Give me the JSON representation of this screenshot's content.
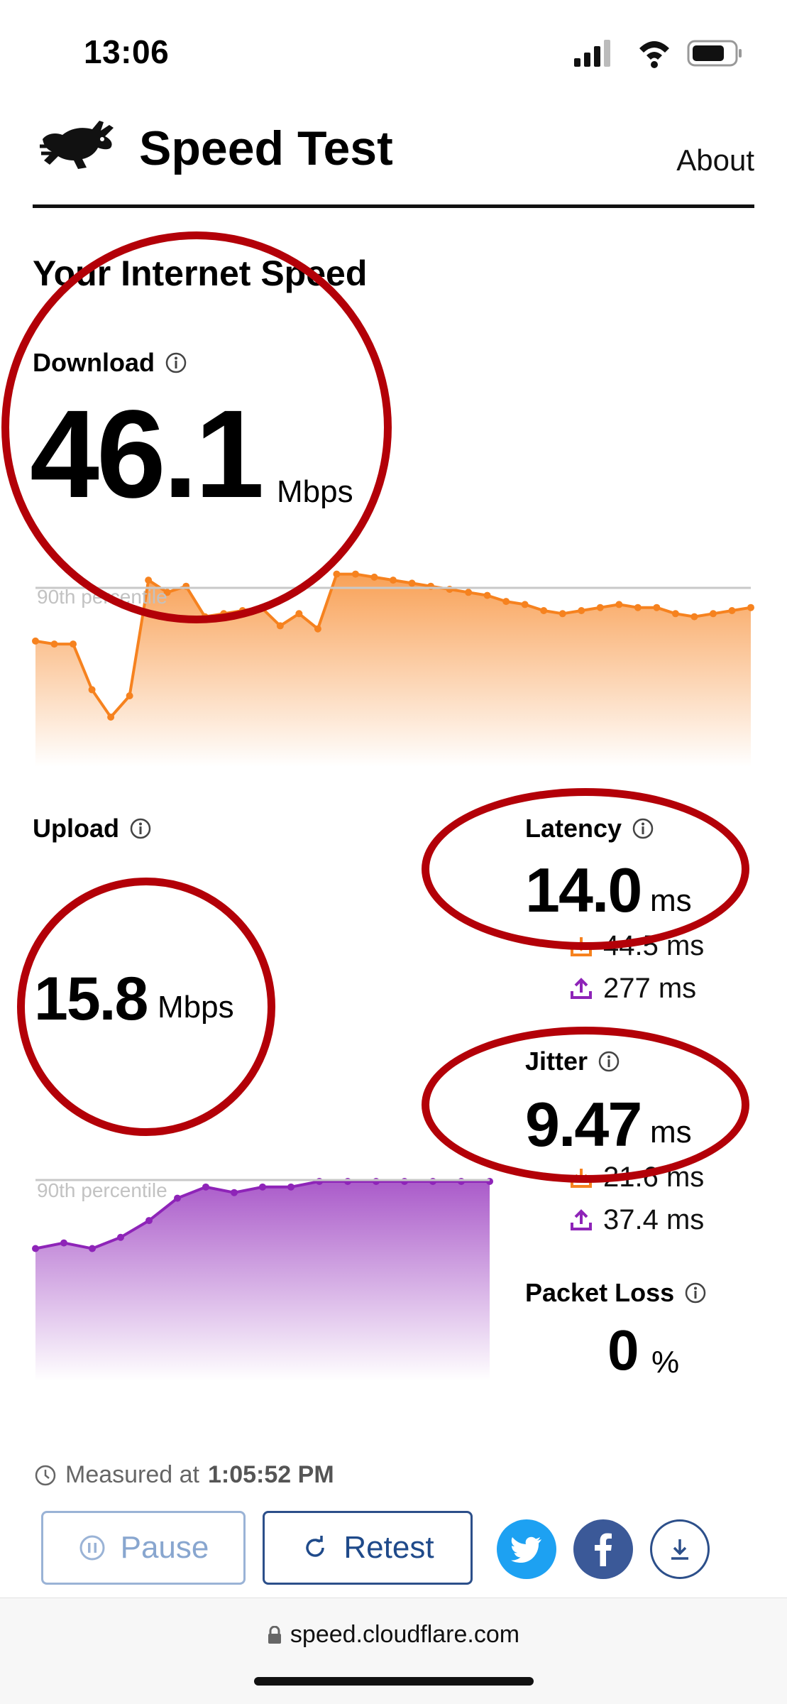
{
  "status_bar": {
    "time": "13:06"
  },
  "header": {
    "title": "Speed Test",
    "about": "About"
  },
  "section_title": "Your Internet Speed",
  "download": {
    "label": "Download",
    "value": "46.1",
    "unit": "Mbps",
    "percentile_label": "90th percentile"
  },
  "upload": {
    "label": "Upload",
    "value": "15.8",
    "unit": "Mbps",
    "percentile_label": "90th percentile"
  },
  "latency": {
    "label": "Latency",
    "value": "14.0",
    "unit": "ms",
    "loaded_down": "44.5 ms",
    "loaded_up": "277 ms"
  },
  "jitter": {
    "label": "Jitter",
    "value": "9.47",
    "unit": "ms",
    "loaded_down": "21.6 ms",
    "loaded_up": "37.4 ms"
  },
  "packet_loss": {
    "label": "Packet Loss",
    "value": "0",
    "unit": "%"
  },
  "measured": {
    "prefix": "Measured at",
    "time": "1:05:52 PM"
  },
  "buttons": {
    "pause": "Pause",
    "retest": "Retest"
  },
  "url_bar": {
    "url": "speed.cloudflare.com"
  },
  "colors": {
    "download": "#f6821f",
    "upload": "#8e24b8",
    "annotation": "#b30008",
    "twitter": "#1da1f2",
    "facebook": "#3b5998"
  },
  "chart_data": [
    {
      "type": "area",
      "series": [
        {
          "name": "Download",
          "values": [
            32,
            31,
            31,
            16,
            7,
            14,
            52,
            48,
            50,
            40,
            41,
            42,
            43,
            37,
            41,
            36,
            54,
            54,
            53,
            52,
            51,
            50,
            49,
            48,
            47,
            45,
            44,
            42,
            41,
            42,
            43,
            44,
            43,
            43,
            41,
            40,
            41,
            42,
            43
          ]
        }
      ],
      "reference_line": "90th percentile"
    },
    {
      "type": "area",
      "series": [
        {
          "name": "Upload",
          "values": [
            4,
            5,
            4,
            6,
            9,
            13,
            15,
            14,
            15,
            15,
            16,
            16,
            16,
            16,
            16,
            16,
            16
          ]
        }
      ],
      "reference_line": "90th percentile"
    }
  ]
}
